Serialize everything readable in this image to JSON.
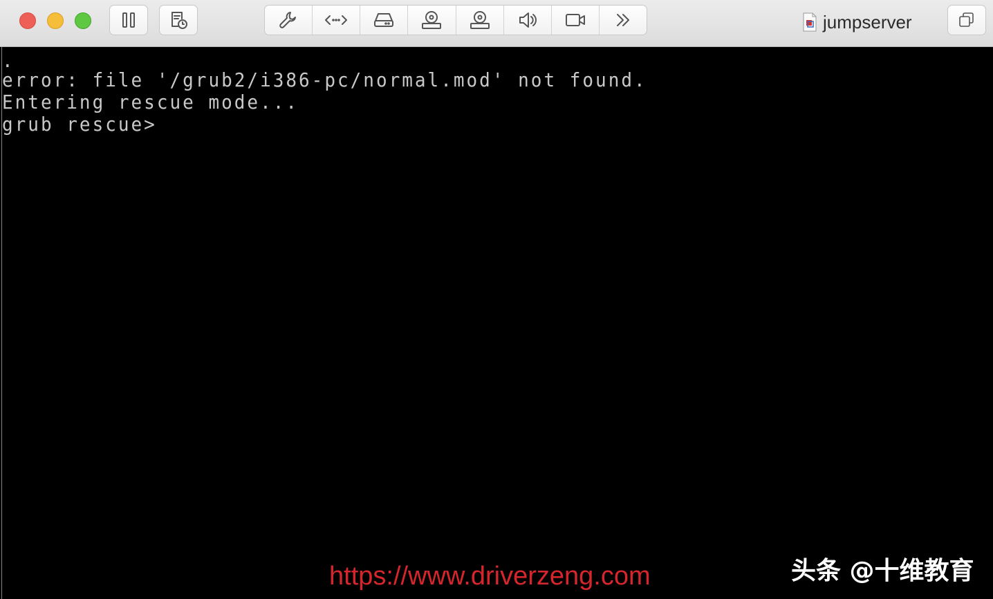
{
  "window": {
    "title": "jumpserver"
  },
  "toolbar": {
    "left_buttons": [
      {
        "icon": "pause-icon"
      },
      {
        "icon": "snapshot-icon"
      }
    ],
    "group_buttons": [
      {
        "icon": "wrench-icon"
      },
      {
        "icon": "code-arrows-icon"
      },
      {
        "icon": "hard-disk-icon"
      },
      {
        "icon": "cd-drive-icon"
      },
      {
        "icon": "cd-drive-icon"
      },
      {
        "icon": "speaker-icon"
      },
      {
        "icon": "camera-icon"
      },
      {
        "icon": "chevron-double-right-icon"
      }
    ],
    "right_button": {
      "icon": "window-copy-icon"
    }
  },
  "console": {
    "lines": [
      ".",
      "error: file '/grub2/i386-pc/normal.mod' not found.",
      "Entering rescue mode...",
      "grub rescue>"
    ]
  },
  "watermark": {
    "url": "https://www.driverzeng.com",
    "brand": "头条 @十维教育"
  },
  "colors": {
    "console_bg": "#000000",
    "console_fg": "#c8c8c8",
    "watermark_url": "#d4262c",
    "traffic_close": "#ee5f57",
    "traffic_min": "#f6bd3b",
    "traffic_max": "#5ec842"
  }
}
